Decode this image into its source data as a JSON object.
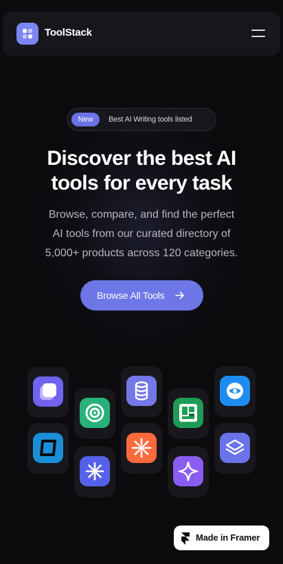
{
  "header": {
    "brand": "ToolStack",
    "logo_icon": "grid-icon",
    "menu_icon": "hamburger-menu-icon"
  },
  "hero": {
    "badge": {
      "tag": "New",
      "text": "Best AI Writing tools listed"
    },
    "headline": [
      "Discover the best AI",
      "tools for every task"
    ],
    "subtitle": [
      "Browse, compare, and find the perfect",
      "AI tools from our curated directory of",
      "5,000+ products across 120 categories."
    ],
    "cta_label": "Browse All Tools"
  },
  "app_icons": [
    {
      "name": "stacked-square-app-icon",
      "color": "#6f63f0"
    },
    {
      "name": "rounded-square-app-icon",
      "color": "#1a8fd8"
    },
    {
      "name": "spiral-app-icon",
      "color": "#28b27a"
    },
    {
      "name": "sparkle-burst-app-icon",
      "color": "#5561e8"
    },
    {
      "name": "coins-stack-app-icon",
      "color": "#7478e6"
    },
    {
      "name": "asterisk-burst-app-icon",
      "color": "#ff6a3d"
    },
    {
      "name": "frame-grid-app-icon",
      "color": "#1f9b56"
    },
    {
      "name": "four-point-star-app-icon",
      "color": "#8a5cf0"
    },
    {
      "name": "eye-circle-app-icon",
      "color": "#1e8cef"
    },
    {
      "name": "layers-app-icon",
      "color": "#6a72ea"
    }
  ],
  "badge_framer": {
    "label": "Made in Framer",
    "icon": "framer-logo-icon"
  },
  "colors": {
    "background": "#0b0b0e",
    "accent": "#6e77e8",
    "text_muted": "#b6b6bf"
  }
}
